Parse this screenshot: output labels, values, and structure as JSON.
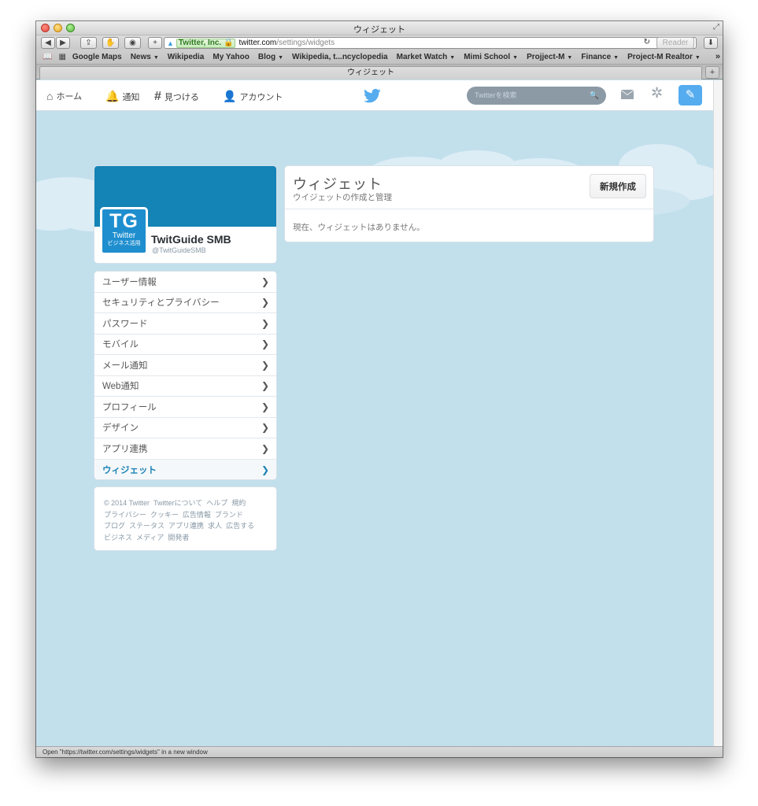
{
  "window": {
    "title": "ウィジェット"
  },
  "toolbar": {
    "ev_label": "Twitter, Inc.",
    "url_host": "twitter.com",
    "url_path": "/settings/widgets",
    "reader_label": "Reader"
  },
  "bookmarks": [
    {
      "label": "Google Maps",
      "dropdown": false
    },
    {
      "label": "News",
      "dropdown": true
    },
    {
      "label": "Wikipedia",
      "dropdown": false
    },
    {
      "label": "My Yahoo",
      "dropdown": false
    },
    {
      "label": "Blog",
      "dropdown": true
    },
    {
      "label": "Wikipedia, t...ncyclopedia",
      "dropdown": false
    },
    {
      "label": "Market Watch",
      "dropdown": true
    },
    {
      "label": "Mimi School",
      "dropdown": true
    },
    {
      "label": "Projject-M",
      "dropdown": true
    },
    {
      "label": "Finance",
      "dropdown": true
    },
    {
      "label": "Project-M Realtor",
      "dropdown": true
    }
  ],
  "tab": {
    "label": "ウィジェット"
  },
  "nav": {
    "home": "ホーム",
    "notifications": "通知",
    "discover": "見つける",
    "account": "アカウント",
    "search_placeholder": "Twitterを検索"
  },
  "profile": {
    "avatar_initials": "TG",
    "avatar_line1": "Twitter",
    "avatar_line2": "ビジネス活用",
    "name": "TwitGuide SMB",
    "handle": "@TwitGuideSMB"
  },
  "menu": [
    {
      "label": "ユーザー情報",
      "active": false
    },
    {
      "label": "セキュリティとプライバシー",
      "active": false
    },
    {
      "label": "パスワード",
      "active": false
    },
    {
      "label": "モバイル",
      "active": false
    },
    {
      "label": "メール通知",
      "active": false
    },
    {
      "label": "Web通知",
      "active": false
    },
    {
      "label": "プロフィール",
      "active": false
    },
    {
      "label": "デザイン",
      "active": false
    },
    {
      "label": "アプリ連携",
      "active": false
    },
    {
      "label": "ウィジェット",
      "active": true
    }
  ],
  "footer": {
    "links": [
      "© 2014 Twitter",
      "Twitterについて",
      "ヘルプ",
      "規約",
      "プライバシー",
      "クッキー",
      "広告情報",
      "ブランド",
      "ブログ",
      "ステータス",
      "アプリ連携",
      "求人",
      "広告する",
      "ビジネス",
      "メディア",
      "開発者"
    ]
  },
  "panel": {
    "title": "ウィジェット",
    "subtitle": "ウイジェットの作成と管理",
    "new_button": "新規作成",
    "empty_message": "現在、ウィジェットはありません。"
  },
  "statusbar": {
    "text": "Open \"https://twitter.com/settings/widgets\" in a new window"
  },
  "colors": {
    "twitter_blue": "#55acee",
    "banner": "#1483b6",
    "background": "#c2dfec",
    "active_link": "#1b83b5"
  }
}
